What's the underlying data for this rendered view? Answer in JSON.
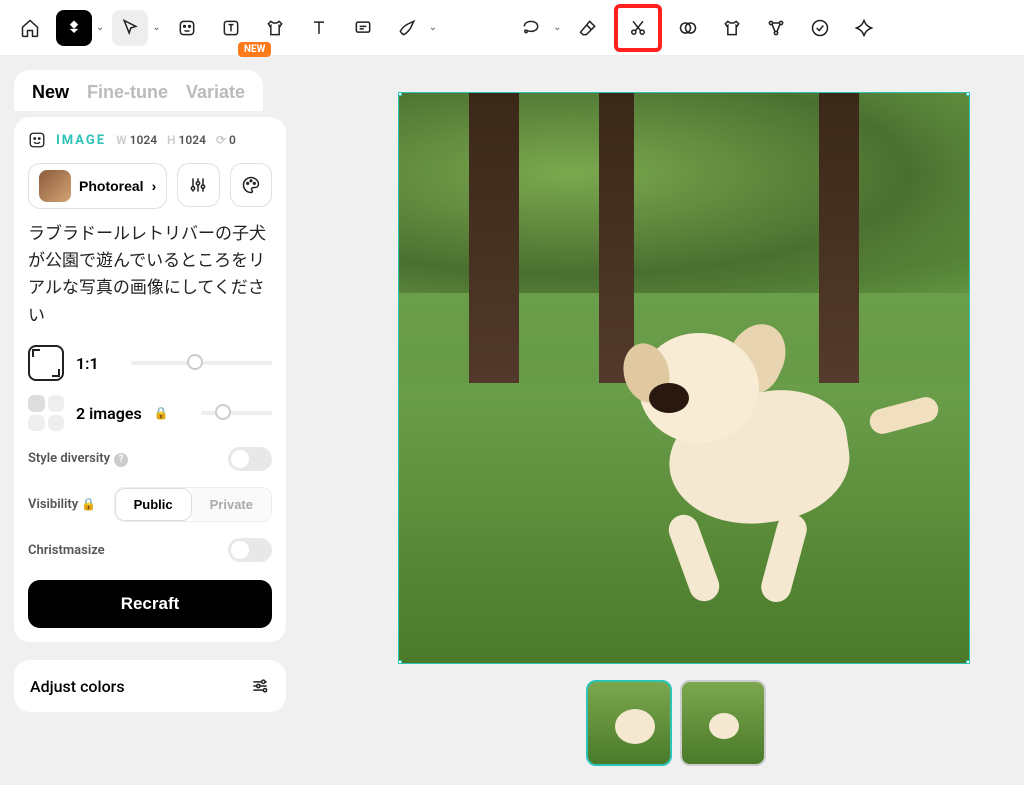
{
  "toolbar": {
    "new_badge": "NEW"
  },
  "tabs": {
    "new": "New",
    "fine_tune": "Fine-tune",
    "variate": "Variate"
  },
  "image_panel": {
    "label": "IMAGE",
    "w_label": "W",
    "w_value": "1024",
    "h_label": "H",
    "h_value": "1024",
    "c_label": "⟳",
    "c_value": "0",
    "style_name": "Photoreal",
    "prompt": "ラブラドールレトリバーの子犬が公園で遊んでいるところをリアルな写真の画像にしてください",
    "ratio_label": "1:1",
    "images_count_label": "2 images",
    "style_diversity_label": "Style diversity",
    "visibility_label": "Visibility",
    "visibility_public": "Public",
    "visibility_private": "Private",
    "christmasize_label": "Christmasize",
    "recraft_button": "Recraft"
  },
  "adjust_colors": {
    "label": "Adjust colors"
  },
  "colors": {
    "accent": "#2bc4b6",
    "highlight": "#ff2020",
    "badge": "#ff7a1a"
  }
}
